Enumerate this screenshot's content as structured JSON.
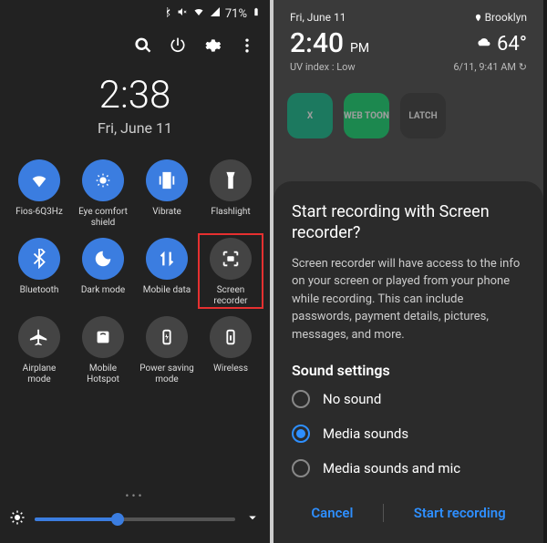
{
  "left": {
    "status": {
      "battery": "71%"
    },
    "clock": {
      "time": "2:38",
      "date": "Fri, June 11"
    },
    "tiles": [
      {
        "label": "Fios-6Q3Hz",
        "icon": "wifi-icon",
        "on": true
      },
      {
        "label": "Eye comfort shield",
        "icon": "eye-comfort-icon",
        "on": true
      },
      {
        "label": "Vibrate",
        "icon": "vibrate-icon",
        "on": true
      },
      {
        "label": "Flashlight",
        "icon": "flashlight-icon",
        "on": false
      },
      {
        "label": "Bluetooth",
        "icon": "bluetooth-icon",
        "on": true
      },
      {
        "label": "Dark mode",
        "icon": "dark-mode-icon",
        "on": true
      },
      {
        "label": "Mobile data",
        "icon": "mobile-data-icon",
        "on": true
      },
      {
        "label": "Screen recorder",
        "icon": "screen-recorder-icon",
        "on": false,
        "highlight": true
      },
      {
        "label": "Airplane mode",
        "icon": "airplane-icon",
        "on": false
      },
      {
        "label": "Mobile Hotspot",
        "icon": "hotspot-icon",
        "on": false
      },
      {
        "label": "Power saving mode",
        "icon": "power-saving-icon",
        "on": false
      },
      {
        "label": "Wireless",
        "icon": "wireless-icon",
        "on": false
      }
    ]
  },
  "right": {
    "status": {
      "date": "Fri, June 11",
      "location": "Brooklyn",
      "time": "2:40",
      "ampm": "PM",
      "temp": "64°",
      "uv": "UV index : Low",
      "updated": "6/11, 9:41 AM"
    },
    "apps": [
      {
        "label": "X",
        "color": "#00b884"
      },
      {
        "label": "WEB TOON",
        "color": "#00d564"
      },
      {
        "label": "LATCH",
        "color": "#2b2b2b"
      }
    ],
    "dialog": {
      "title": "Start recording with Screen recorder?",
      "body": "Screen recorder will have access to the info on your screen or played from your phone while recording. This can include passwords, payment details, pictures, messages, and more.",
      "section": "Sound settings",
      "options": [
        {
          "label": "No sound",
          "checked": false
        },
        {
          "label": "Media sounds",
          "checked": true
        },
        {
          "label": "Media sounds and mic",
          "checked": false
        }
      ],
      "cancel": "Cancel",
      "confirm": "Start recording"
    }
  }
}
